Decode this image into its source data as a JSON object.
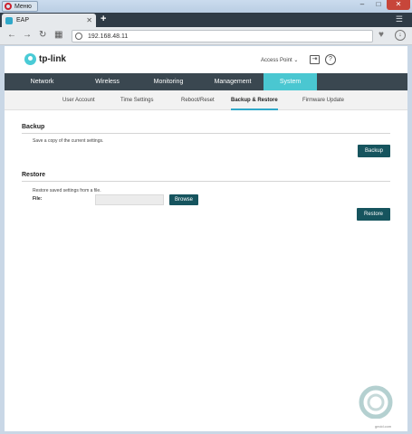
{
  "browser": {
    "menu_label": "Меню",
    "tab_title": "EAP",
    "url": "192.168.48.11"
  },
  "header": {
    "brand": "tp-link",
    "mode": "Access Point"
  },
  "main_nav": [
    "Network",
    "Wireless",
    "Monitoring",
    "Management",
    "System"
  ],
  "sub_nav": [
    "User Account",
    "Time Settings",
    "Reboot/Reset",
    "Backup & Restore",
    "Firmware Update"
  ],
  "backup": {
    "title": "Backup",
    "description": "Save a copy of the current settings.",
    "button": "Backup"
  },
  "restore": {
    "title": "Restore",
    "description": "Restore saved settings from a file.",
    "file_label": "File:",
    "browse_button": "Browse",
    "button": "Restore"
  },
  "watermark": "gecid.com",
  "colors": {
    "accent": "#4ac7d1",
    "nav_bg": "#3a4750",
    "button": "#16545e"
  }
}
